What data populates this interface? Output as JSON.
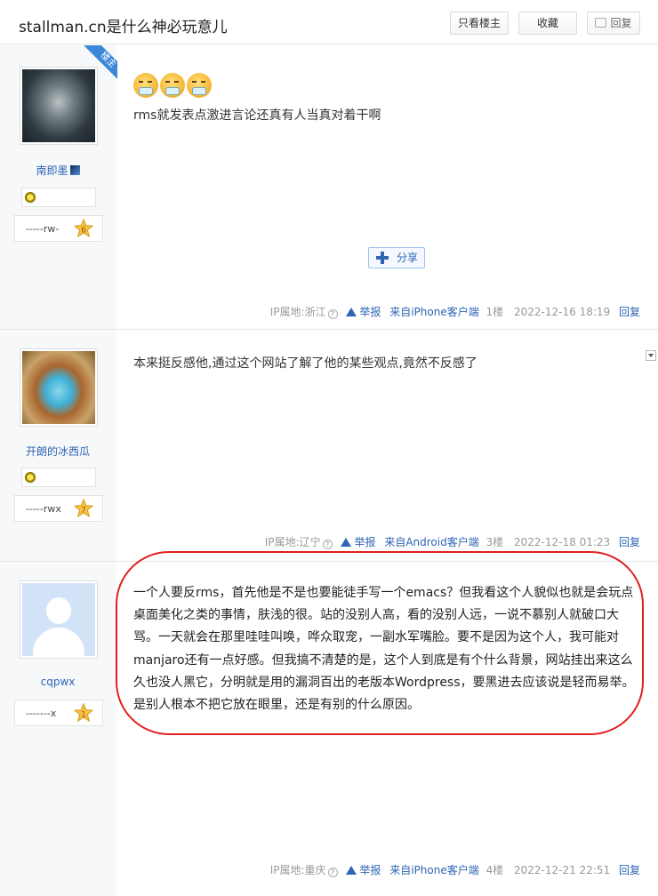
{
  "header": {
    "title": "stallman.cn是什么神必玩意儿",
    "buttons": {
      "only_op": "只看楼主",
      "favorite": "收藏",
      "reply": "回复"
    }
  },
  "posts": [
    {
      "username": "南即墨",
      "op_badge": "楼主",
      "level_text": "-----rw-",
      "level": "6",
      "content": "rms就发表点激进言论还真有人当真对着干啊",
      "share_label": "分享",
      "ip": "IP属地:浙江",
      "report": "举报",
      "client": "来自iPhone客户端",
      "floor": "1楼",
      "time": "2022-12-16 18:19",
      "reply": "回复"
    },
    {
      "username": "开朗的冰西瓜",
      "level_text": "-----rwx",
      "level": "7",
      "content": "本来挺反感他,通过这个网站了解了他的某些观点,竟然不反感了",
      "ip": "IP属地:辽宁",
      "report": "举报",
      "client": "来自Android客户端",
      "floor": "3楼",
      "time": "2022-12-18 01:23",
      "reply": "回复"
    },
    {
      "username": "cqpwx",
      "level_text": "-------x",
      "level": "1",
      "content": "一个人要反rms，首先他是不是也要能徒手写一个emacs？但我看这个人貌似也就是会玩点桌面美化之类的事情，肤浅的很。站的没别人高，看的没别人远，一说不慕别人就破口大骂。一天就会在那里哇哇叫唤，哗众取宠，一副水军嘴脸。要不是因为这个人，我可能对manjaro还有一点好感。但我搞不清楚的是，这个人到底是有个什么背景，网站挂出来这么久也没人黑它，分明就是用的漏洞百出的老版本Wordpress，要黑进去应该说是轻而易举。是别人根本不把它放在眼里，还是有别的什么原因。",
      "ip": "IP属地:重庆",
      "report": "举报",
      "client": "来自iPhone客户端",
      "floor": "4楼",
      "time": "2022-12-21 22:51",
      "reply": "回复"
    }
  ],
  "colors": {
    "link": "#2d64b3",
    "highlight": "#e02020",
    "sidebar": "#f7f8fa"
  },
  "icons": [
    "question-icon",
    "warning-icon",
    "share-plus-icon",
    "reply-bubble-icon",
    "level-star-icon",
    "sun-badge-icon",
    "emoji-icon"
  ]
}
